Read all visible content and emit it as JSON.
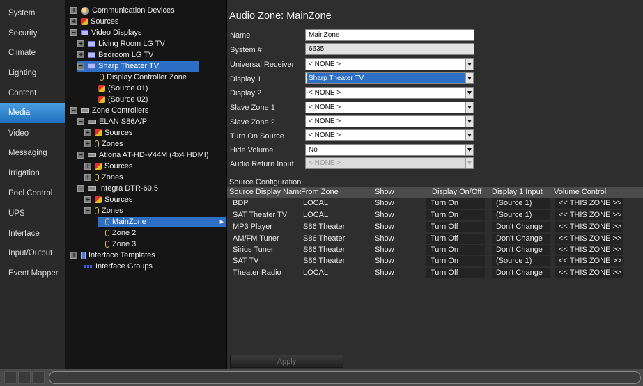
{
  "nav": {
    "items": [
      {
        "label": "System"
      },
      {
        "label": "Security"
      },
      {
        "label": "Climate"
      },
      {
        "label": "Lighting"
      },
      {
        "label": "Content"
      },
      {
        "label": "Media"
      },
      {
        "label": "Video"
      },
      {
        "label": "Messaging"
      },
      {
        "label": "Irrigation"
      },
      {
        "label": "Pool Control"
      },
      {
        "label": "UPS"
      },
      {
        "label": "Interface"
      },
      {
        "label": "Input/Output"
      },
      {
        "label": "Event Mapper"
      }
    ],
    "active": "Media"
  },
  "tree": {
    "items": [
      {
        "label": "Communication Devices",
        "icon": "communication-icon",
        "toggle": "+"
      },
      {
        "label": "Sources",
        "icon": "sources-icon",
        "toggle": "+"
      },
      {
        "label": "Video Displays",
        "icon": "display-icon",
        "toggle": "-"
      },
      {
        "label": "Living Room LG TV",
        "icon": "display-icon",
        "toggle": "+"
      },
      {
        "label": "Bedroom LG TV",
        "icon": "display-icon",
        "toggle": "+"
      },
      {
        "label": "Sharp Theater TV",
        "icon": "display-icon",
        "toggle": "-"
      },
      {
        "label": "Display Controller Zone",
        "icon": "zone-icon",
        "toggle": ""
      },
      {
        "label": "(Source 01)",
        "icon": "sources-icon",
        "toggle": ""
      },
      {
        "label": "(Source 02)",
        "icon": "sources-icon",
        "toggle": ""
      },
      {
        "label": "Zone Controllers",
        "icon": "controller-icon",
        "toggle": "-"
      },
      {
        "label": "ELAN S86A/P",
        "icon": "controller-icon",
        "toggle": "-"
      },
      {
        "label": "Sources",
        "icon": "sources-icon",
        "toggle": "+"
      },
      {
        "label": "Zones",
        "icon": "zone-icon",
        "toggle": "+"
      },
      {
        "label": "Atlona AT-HD-V44M (4x4 HDMI)",
        "icon": "controller-icon",
        "toggle": "-"
      },
      {
        "label": "Sources",
        "icon": "sources-icon",
        "toggle": "+"
      },
      {
        "label": "Zones",
        "icon": "zone-icon",
        "toggle": "+"
      },
      {
        "label": "Integra DTR-60.5",
        "icon": "controller-icon",
        "toggle": "-"
      },
      {
        "label": "Sources",
        "icon": "sources-icon",
        "toggle": "+"
      },
      {
        "label": "Zones",
        "icon": "zone-icon",
        "toggle": "-"
      },
      {
        "label": "MainZone",
        "icon": "zone-icon",
        "toggle": ""
      },
      {
        "label": "Zone 2",
        "icon": "zone-icon",
        "toggle": ""
      },
      {
        "label": "Zone 3",
        "icon": "zone-icon",
        "toggle": ""
      },
      {
        "label": "Interface Templates",
        "icon": "template-icon",
        "toggle": "+"
      },
      {
        "label": "Interface Groups",
        "icon": "groups-icon",
        "toggle": ""
      }
    ]
  },
  "main": {
    "title": "Audio Zone: MainZone",
    "fields": {
      "name": {
        "label": "Name",
        "value": "MainZone"
      },
      "system": {
        "label": "System #",
        "value": "6635"
      },
      "universal_receiver": {
        "label": "Universal Receiver",
        "value": "< NONE >"
      },
      "display1": {
        "label": "Display 1",
        "value": "Sharp Theater TV"
      },
      "display2": {
        "label": "Display 2",
        "value": "< NONE >"
      },
      "slave1": {
        "label": "Slave Zone 1",
        "value": "< NONE >"
      },
      "slave2": {
        "label": "Slave Zone 2",
        "value": "< NONE >"
      },
      "turn_on_source": {
        "label": "Turn On Source",
        "value": "< NONE >"
      },
      "hide_volume": {
        "label": "Hide Volume",
        "value": "No"
      },
      "audio_return": {
        "label": "Audio Return Input",
        "value": "< NONE >"
      }
    },
    "source_config": {
      "title": "Source Configuration",
      "headers": [
        "Source Display Name",
        "From Zone",
        "Show",
        "Display On/Off",
        "Display 1 Input",
        "Volume Control"
      ],
      "rows": [
        [
          "BDP",
          "LOCAL",
          "Show",
          "Turn On",
          "(Source 1)",
          "<< THIS ZONE >>"
        ],
        [
          "SAT Theater TV",
          "LOCAL",
          "Show",
          "Turn On",
          "(Source 1)",
          "<< THIS ZONE >>"
        ],
        [
          "MP3 Player",
          "S86 Theater",
          "Show",
          "Turn Off",
          "Don't Change",
          "<< THIS ZONE >>"
        ],
        [
          "AM/FM Tuner",
          "S86 Theater",
          "Show",
          "Turn Off",
          "Don't Change",
          "<< THIS ZONE >>"
        ],
        [
          "Sirius Tuner",
          "S86 Theater",
          "Show",
          "Turn On",
          "Don't Change",
          "<< THIS ZONE >>"
        ],
        [
          "SAT TV",
          "S86 Theater",
          "Show",
          "Turn On",
          "(Source 1)",
          "<< THIS ZONE >>"
        ],
        [
          "Theater Radio",
          "LOCAL",
          "Show",
          "Turn Off",
          "Don't Change",
          "<< THIS ZONE >>"
        ]
      ]
    },
    "apply_label": "Apply"
  },
  "colors": {
    "accent": "#2d6fc6",
    "nav_active": "#3a8fd8",
    "panel_bg": "#2e2e2e",
    "tree_bg": "#151515"
  }
}
